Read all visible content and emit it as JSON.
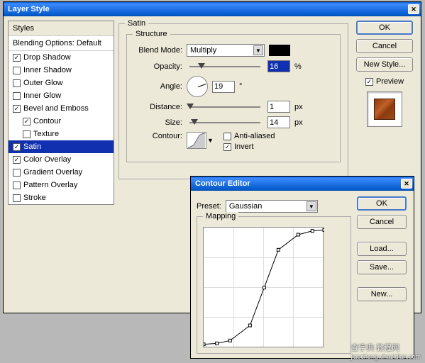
{
  "layerStyle": {
    "title": "Layer Style",
    "stylesHeader": "Styles",
    "blendingHeader": "Blending Options: Default",
    "items": [
      {
        "label": "Drop Shadow",
        "checked": true
      },
      {
        "label": "Inner Shadow",
        "checked": false
      },
      {
        "label": "Outer Glow",
        "checked": false
      },
      {
        "label": "Inner Glow",
        "checked": false
      },
      {
        "label": "Bevel and Emboss",
        "checked": true
      },
      {
        "label": "Contour",
        "checked": true,
        "indent": true
      },
      {
        "label": "Texture",
        "checked": false,
        "indent": true
      },
      {
        "label": "Satin",
        "checked": true,
        "selected": true
      },
      {
        "label": "Color Overlay",
        "checked": true
      },
      {
        "label": "Gradient Overlay",
        "checked": false
      },
      {
        "label": "Pattern Overlay",
        "checked": false
      },
      {
        "label": "Stroke",
        "checked": false
      }
    ],
    "section": "Satin",
    "structure": "Structure",
    "blendModeLabel": "Blend Mode:",
    "blendModeValue": "Multiply",
    "opacityLabel": "Opacity:",
    "opacityValue": "16",
    "opacityUnit": "%",
    "angleLabel": "Angle:",
    "angleValue": "19",
    "angleUnit": "°",
    "distanceLabel": "Distance:",
    "distanceValue": "1",
    "distanceUnit": "px",
    "sizeLabel": "Size:",
    "sizeValue": "14",
    "sizeUnit": "px",
    "contourLabel": "Contour:",
    "antiAliased": "Anti-aliased",
    "invert": "Invert",
    "buttons": {
      "ok": "OK",
      "cancel": "Cancel",
      "newStyle": "New Style..."
    },
    "previewLabel": "Preview",
    "colorSwatch": "#000000"
  },
  "contourEditor": {
    "title": "Contour Editor",
    "presetLabel": "Preset:",
    "presetValue": "Gaussian",
    "mappingLabel": "Mapping",
    "buttons": {
      "ok": "OK",
      "cancel": "Cancel",
      "load": "Load...",
      "save": "Save...",
      "new": "New..."
    }
  },
  "chart_data": {
    "type": "line",
    "title": "Mapping",
    "xlabel": "",
    "ylabel": "",
    "xlim": [
      0,
      255
    ],
    "ylim": [
      0,
      255
    ],
    "x": [
      0,
      28,
      56,
      98,
      128,
      158,
      200,
      230,
      255
    ],
    "values": [
      8,
      10,
      16,
      48,
      128,
      208,
      240,
      248,
      250
    ]
  },
  "watermark": {
    "main": "查字典",
    "sub": "jiaocheng.chazidian.com",
    "tag": "教程网"
  }
}
